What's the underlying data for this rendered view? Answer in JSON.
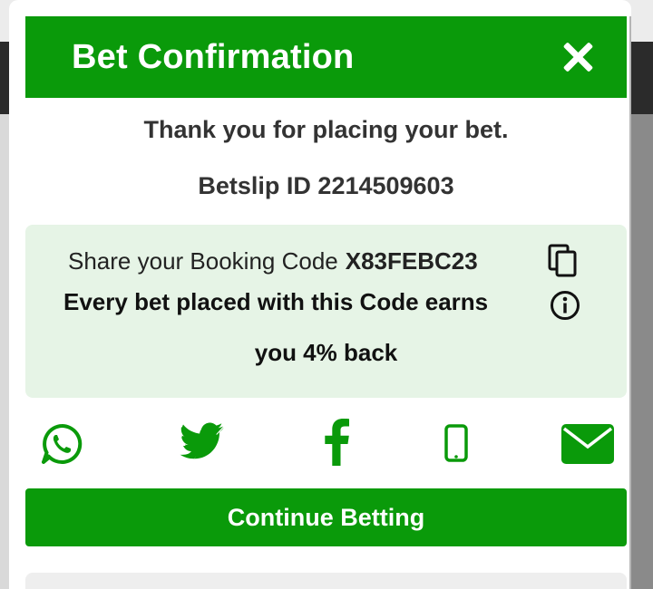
{
  "dialog": {
    "title": "Bet Confirmation",
    "close_icon": "close-icon",
    "thank_you": "Thank you for placing your bet.",
    "betslip_id": "Betslip ID 2214509603"
  },
  "share": {
    "prefix": "Share your Booking Code",
    "booking_code": "X83FEBC23",
    "earn_line_1": "Every bet placed with this Code earns",
    "earn_line_2": "you 4% back",
    "copy_icon": "copy-icon",
    "info_icon": "info-icon"
  },
  "social": [
    "whatsapp-icon",
    "twitter-icon",
    "facebook-icon",
    "mobile-phone-icon",
    "email-icon"
  ],
  "actions": {
    "continue_label": "Continue Betting"
  },
  "colors": {
    "brand_green": "#0a9a0a",
    "share_background": "#e6f4e6",
    "text_dark": "#333333"
  }
}
